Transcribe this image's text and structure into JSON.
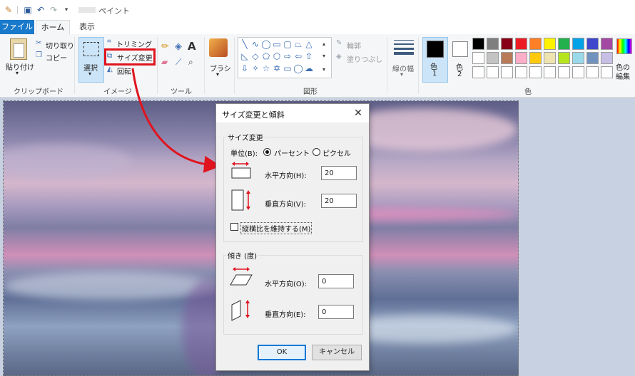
{
  "window": {
    "app_title": "ペイント"
  },
  "tabs": [
    {
      "label": "ファイル"
    },
    {
      "label": "ホーム"
    },
    {
      "label": "表示"
    }
  ],
  "ribbon": {
    "clipboard": {
      "paste": "貼り付け",
      "cut": "切り取り",
      "copy": "コピー",
      "group": "クリップボード"
    },
    "image": {
      "select": "選択",
      "crop": "トリミング",
      "resize": "サイズ変更",
      "rotate": "回転",
      "group": "イメージ"
    },
    "tools": {
      "group": "ツール"
    },
    "brush": {
      "label": "ブラシ"
    },
    "shapes": {
      "outline": "輪郭",
      "fill": "塗りつぶし",
      "group": "図形"
    },
    "size": {
      "label": "線の幅"
    },
    "colors": {
      "color1": "色",
      "color1_num": "1",
      "color2": "色",
      "color2_num": "2",
      "edit": "色の",
      "edit2": "編集",
      "group": "色",
      "palette_row1": [
        "#000000",
        "#7f7f7f",
        "#880015",
        "#ed1c24",
        "#ff7f27",
        "#fff200",
        "#22b14c",
        "#00a2e8",
        "#3f48cc",
        "#a349a4"
      ],
      "palette_row2": [
        "#ffffff",
        "#c3c3c3",
        "#b97a57",
        "#ffaec9",
        "#ffc90e",
        "#efe4b0",
        "#b5e61d",
        "#99d9ea",
        "#7092be",
        "#c8bfe7"
      ]
    }
  },
  "dialog": {
    "title": "サイズ変更と傾斜",
    "close": "✕",
    "resize": {
      "legend": "サイズ変更",
      "unit_label": "単位(B):",
      "percent": "パーセント",
      "pixel": "ピクセル",
      "horizontal_label": "水平方向(H):",
      "horizontal_value": "20",
      "vertical_label": "垂直方向(V):",
      "vertical_value": "20",
      "keep_ratio": "縦横比を維持する(M)"
    },
    "skew": {
      "legend": "傾き (度)",
      "horizontal_label": "水平方向(O):",
      "horizontal_value": "0",
      "vertical_label": "垂直方向(E):",
      "vertical_value": "0"
    },
    "ok": "OK",
    "cancel": "キャンセル"
  }
}
